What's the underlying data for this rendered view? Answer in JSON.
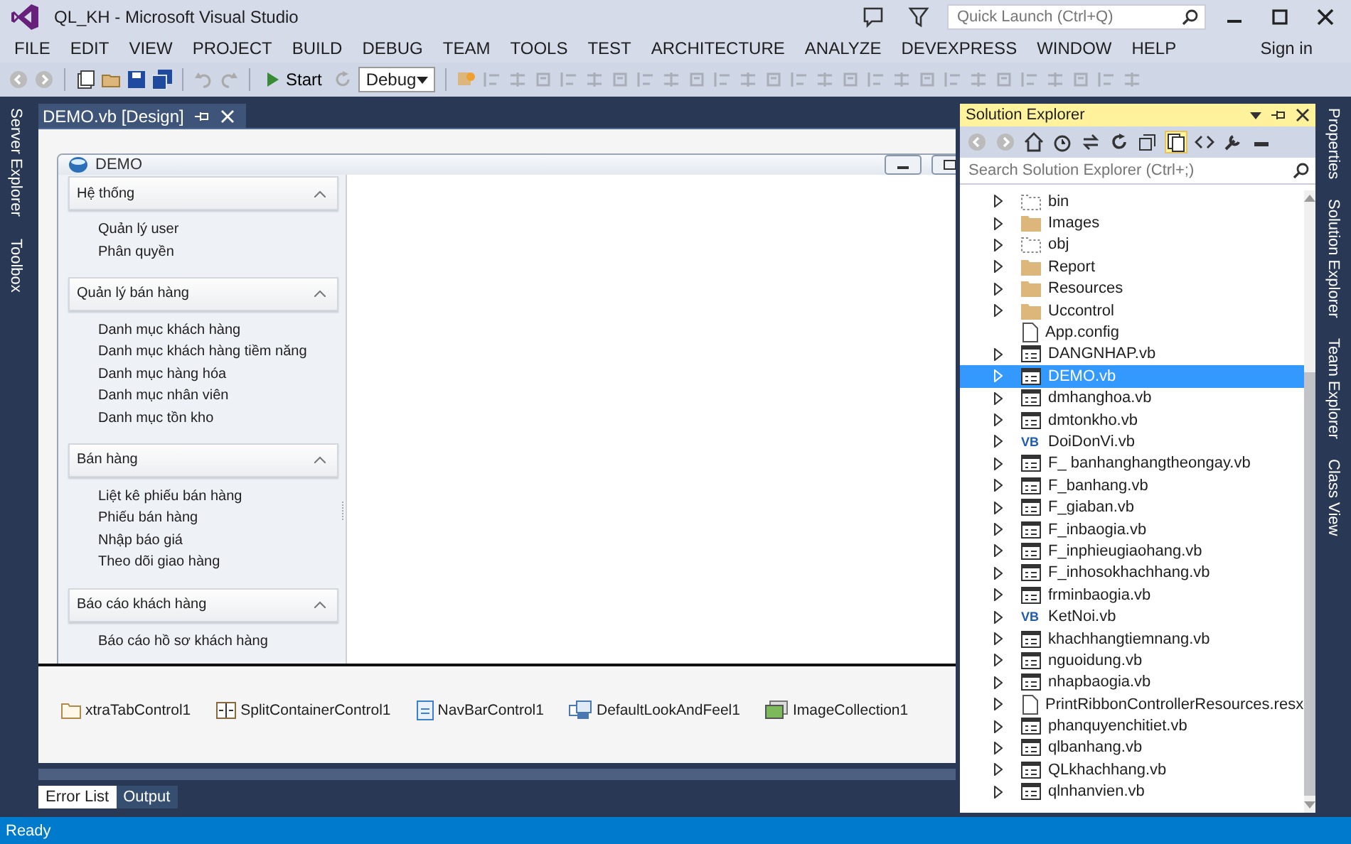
{
  "window": {
    "title": "QL_KH - Microsoft Visual Studio",
    "quick_launch": {
      "placeholder": "Quick Launch (Ctrl+Q)"
    },
    "sign_in": "Sign in"
  },
  "menu": [
    "FILE",
    "EDIT",
    "VIEW",
    "PROJECT",
    "BUILD",
    "DEBUG",
    "TEAM",
    "TOOLS",
    "TEST",
    "ARCHITECTURE",
    "ANALYZE",
    "DEVEXPRESS",
    "WINDOW",
    "HELP"
  ],
  "toolbar": {
    "start": "Start",
    "configuration": "Debug"
  },
  "left_tabs": [
    "Server Explorer",
    "Toolbox"
  ],
  "document_tab": {
    "label": "DEMO.vb [Design]"
  },
  "form": {
    "title": "DEMO",
    "groups": [
      {
        "title": "Hệ thống",
        "expanded": true,
        "items": [
          "Quản lý user",
          "Phân quyền"
        ]
      },
      {
        "title": "Quản lý bán hàng",
        "expanded": true,
        "items": [
          "Danh mục khách hàng",
          "Danh mục khách hàng tiềm năng",
          "Danh mục hàng hóa",
          "Danh mục nhân viên",
          "Danh mục tồn kho"
        ]
      },
      {
        "title": "Bán hàng",
        "expanded": true,
        "items": [
          "Liệt kê phiếu bán hàng",
          "Phiếu bán hàng",
          "Nhập báo giá",
          "Theo dõi giao hàng"
        ]
      },
      {
        "title": "Báo cáo khách hàng",
        "expanded": true,
        "items": [
          "Báo cáo hồ sơ khách hàng"
        ]
      }
    ]
  },
  "tray": [
    {
      "kind": "tab",
      "label": "xtraTabControl1"
    },
    {
      "kind": "split",
      "label": "SplitContainerControl1"
    },
    {
      "kind": "navbar",
      "label": "NavBarControl1"
    },
    {
      "kind": "look",
      "label": "DefaultLookAndFeel1"
    },
    {
      "kind": "images",
      "label": "ImageCollection1"
    }
  ],
  "bottom_tabs": [
    {
      "label": "Error List",
      "selected": true
    },
    {
      "label": "Output",
      "selected": false
    }
  ],
  "solution_explorer": {
    "title": "Solution Explorer",
    "search": {
      "placeholder": "Search Solution Explorer (Ctrl+;)"
    },
    "items": [
      {
        "name": "bin",
        "kind": "hidden-folder",
        "expandable": true,
        "selected": false
      },
      {
        "name": "Images",
        "kind": "folder",
        "expandable": true,
        "selected": false
      },
      {
        "name": "obj",
        "kind": "hidden-folder",
        "expandable": true,
        "selected": false
      },
      {
        "name": "Report",
        "kind": "folder",
        "expandable": true,
        "selected": false
      },
      {
        "name": "Resources",
        "kind": "folder",
        "expandable": true,
        "selected": false
      },
      {
        "name": "Uccontrol",
        "kind": "folder",
        "expandable": true,
        "selected": false
      },
      {
        "name": "App.config",
        "kind": "file",
        "expandable": false,
        "selected": false
      },
      {
        "name": "DANGNHAP.vb",
        "kind": "form",
        "expandable": true,
        "selected": false
      },
      {
        "name": "DEMO.vb",
        "kind": "form",
        "expandable": true,
        "selected": true
      },
      {
        "name": "dmhanghoa.vb",
        "kind": "form",
        "expandable": true,
        "selected": false
      },
      {
        "name": "dmtonkho.vb",
        "kind": "form",
        "expandable": true,
        "selected": false
      },
      {
        "name": "DoiDonVi.vb",
        "kind": "module",
        "icon_text": "VB",
        "expandable": true,
        "selected": false
      },
      {
        "name": "F_ banhanghangtheongay.vb",
        "kind": "form",
        "expandable": true,
        "selected": false
      },
      {
        "name": "F_banhang.vb",
        "kind": "form",
        "expandable": true,
        "selected": false
      },
      {
        "name": "F_giaban.vb",
        "kind": "form",
        "expandable": true,
        "selected": false
      },
      {
        "name": "F_inbaogia.vb",
        "kind": "form",
        "expandable": true,
        "selected": false
      },
      {
        "name": "F_inphieugiaohang.vb",
        "kind": "form",
        "expandable": true,
        "selected": false
      },
      {
        "name": "F_inhosokhachhang.vb",
        "kind": "form",
        "expandable": true,
        "selected": false
      },
      {
        "name": "frminbaogia.vb",
        "kind": "form",
        "expandable": true,
        "selected": false
      },
      {
        "name": "KetNoi.vb",
        "kind": "module",
        "icon_text": "VB",
        "expandable": true,
        "selected": false
      },
      {
        "name": "khachhangtiemnang.vb",
        "kind": "form",
        "expandable": true,
        "selected": false
      },
      {
        "name": "nguoidung.vb",
        "kind": "form",
        "expandable": true,
        "selected": false
      },
      {
        "name": "nhapbaogia.vb",
        "kind": "form",
        "expandable": true,
        "selected": false
      },
      {
        "name": "PrintRibbonControllerResources.resx",
        "kind": "file",
        "expandable": true,
        "selected": false
      },
      {
        "name": "phanquyenchitiet.vb",
        "kind": "form",
        "expandable": true,
        "selected": false
      },
      {
        "name": "qlbanhang.vb",
        "kind": "form",
        "expandable": true,
        "selected": false
      },
      {
        "name": "QLkhachhang.vb",
        "kind": "form",
        "expandable": true,
        "selected": false
      },
      {
        "name": "qlnhanvien.vb",
        "kind": "form",
        "expandable": true,
        "selected": false
      }
    ]
  },
  "right_tabs": [
    "Properties",
    "Solution Explorer",
    "Team Explorer",
    "Class View"
  ],
  "status_bar": {
    "text": "Ready"
  }
}
